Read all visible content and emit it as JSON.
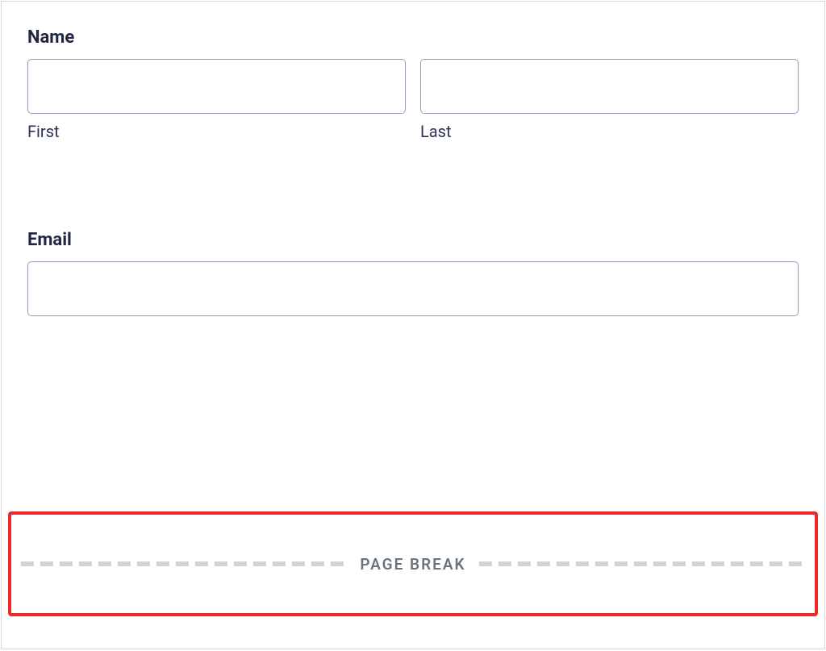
{
  "form": {
    "name": {
      "label": "Name",
      "first": {
        "sublabel": "First",
        "value": ""
      },
      "last": {
        "sublabel": "Last",
        "value": ""
      }
    },
    "email": {
      "label": "Email",
      "value": ""
    }
  },
  "page_break": {
    "label": "PAGE BREAK"
  }
}
